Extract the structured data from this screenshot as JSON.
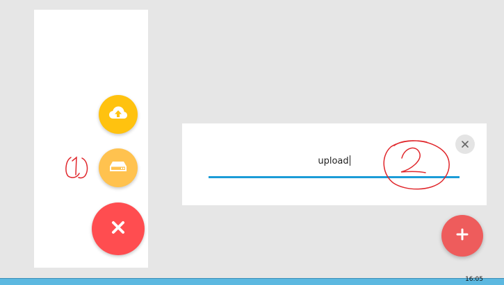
{
  "left_panel": {
    "upload_fab": {
      "icon": "cloud-upload-icon",
      "color": "#ffc20f"
    },
    "drive_fab": {
      "icon": "drive-icon",
      "color": "#ffc24f"
    },
    "close_fab": {
      "icon": "close-icon",
      "color": "#ff4d50"
    }
  },
  "dialog": {
    "input_value": "upload",
    "close_icon": "close-icon",
    "accent_color": "#1a9bd7"
  },
  "add_fab": {
    "icon": "plus-icon",
    "color": "#ee5c5c"
  },
  "annotations": {
    "label_1": "1",
    "label_2": "2",
    "color": "#e0262b"
  },
  "taskbar": {
    "clock": "16:05"
  }
}
